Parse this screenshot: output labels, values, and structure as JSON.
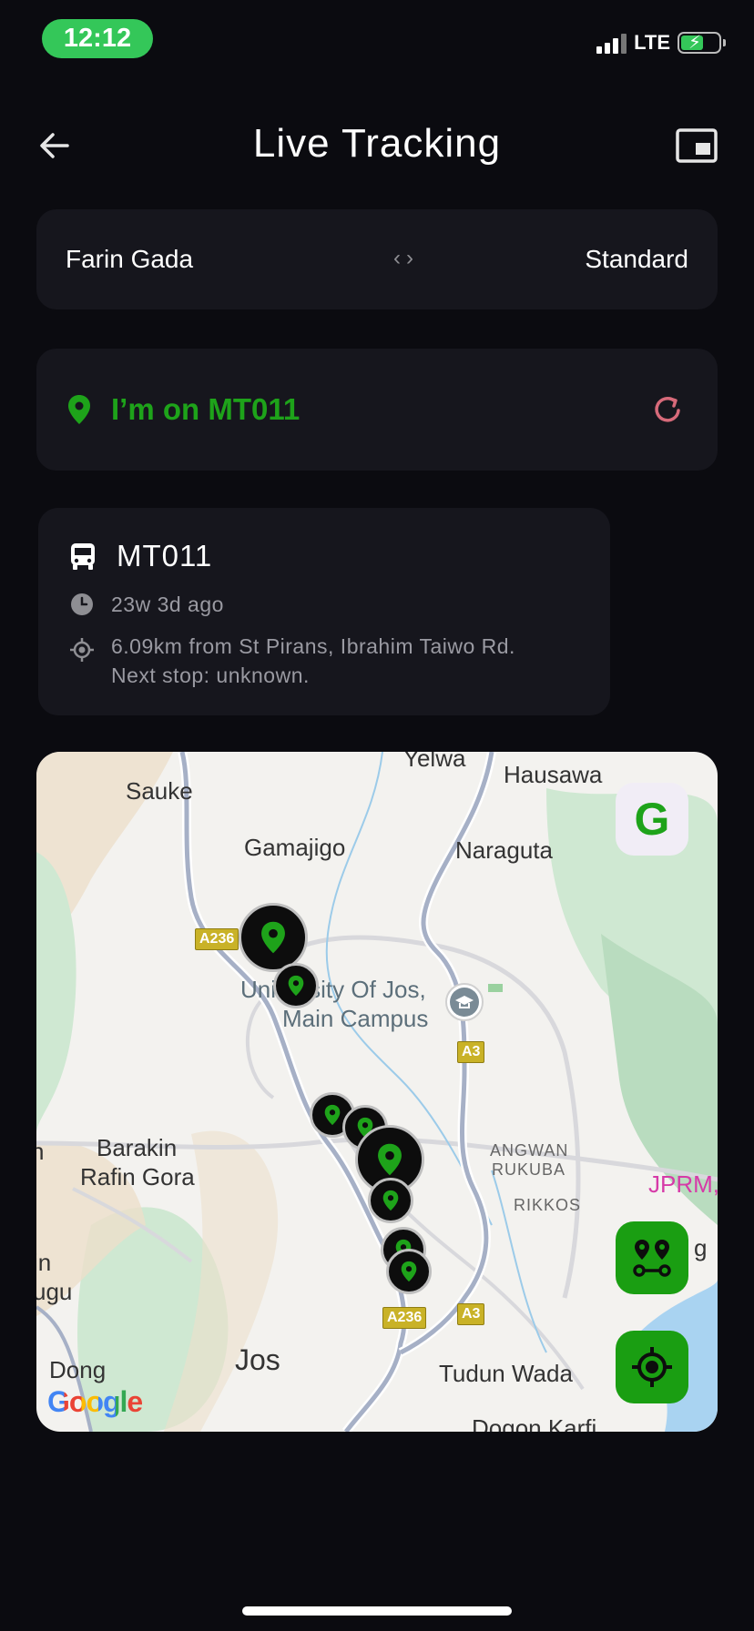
{
  "status_bar": {
    "time": "12:12",
    "network": "LTE"
  },
  "header": {
    "title": "Live Tracking"
  },
  "user_card": {
    "name": "Farin Gada",
    "service": "Standard"
  },
  "onboard_card": {
    "text": "I’m on MT011",
    "text_color": "#1ea31a"
  },
  "vehicle_card": {
    "id": "MT011",
    "last_seen": "23w 3d ago",
    "location_line1": "6.09km from St Pirans, Ibrahim Taiwo Rd.",
    "location_line2": "Next stop: unknown."
  },
  "map": {
    "labels": {
      "yelwa": "Yelwa",
      "hausawa": "Hausawa",
      "sauke": "Sauke",
      "gamajigo": "Gamajigo",
      "naraguta": "Naraguta",
      "university1": "University Of Jos,",
      "university2": "Main Campus",
      "barakin1": "Barakin",
      "barakin2": "Rafin Gora",
      "angwan1": "ANGWAN",
      "angwan2": "RUKUBA",
      "rikkos": "RIKKOS",
      "jprm": "JPRM,",
      "jos": "Jos",
      "dong": "Dong",
      "tudun_wada": "Tudun Wada",
      "dogon_karfi": "Dogon Karfi",
      "edge_n": "n",
      "edge_in": "in",
      "edge_ugu": "ugu",
      "edge_g": "g"
    },
    "road_shields": {
      "a236_top": "A236",
      "a236_bottom": "A236",
      "a3_top": "A3",
      "a3_bottom": "A3"
    },
    "g_button": "G",
    "attribution": "Google",
    "accent_color": "#1a9e12"
  }
}
